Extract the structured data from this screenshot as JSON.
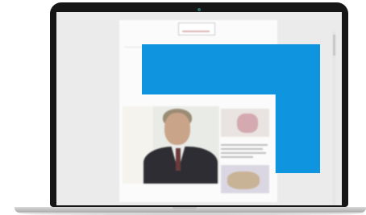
{
  "colors": {
    "bezel": "#161616",
    "screen": "#ebebeb",
    "page": "#fbfbfb",
    "overlay_blue": "#0f95e0"
  },
  "webpage": {
    "meta_left": "",
    "logo_text": "",
    "actions_right": "",
    "nav_items": [
      "",
      "",
      "",
      "",
      "",
      "",
      "",
      ""
    ],
    "hero_tag": "",
    "hero_headline": "",
    "side_tag": ""
  },
  "icons": {
    "camera": "camera-dot-icon"
  }
}
